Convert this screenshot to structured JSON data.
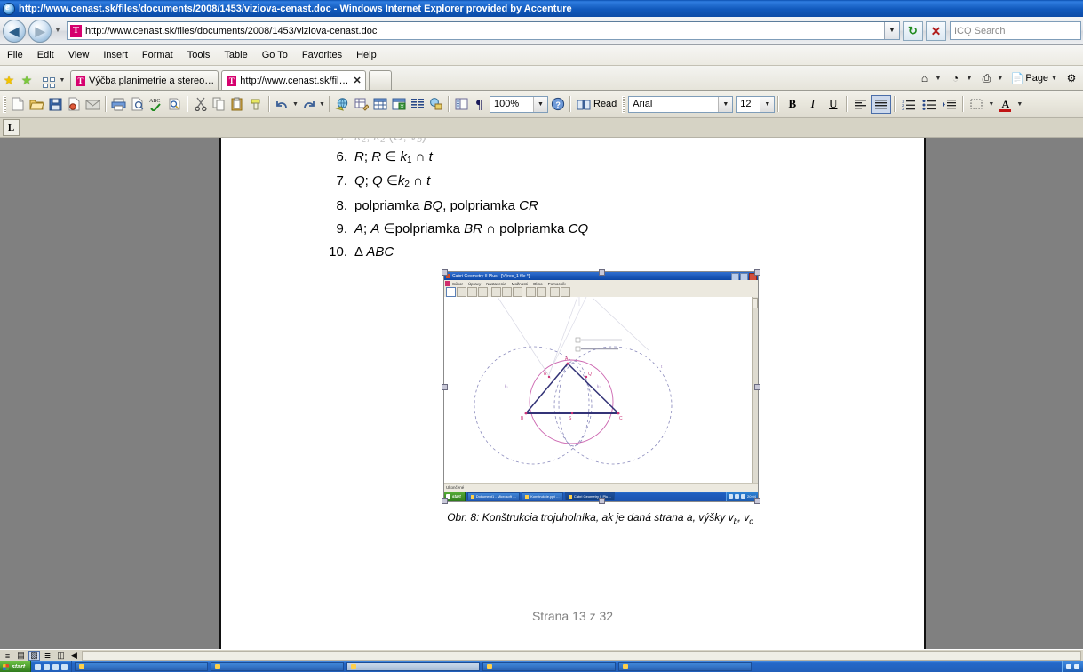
{
  "window": {
    "title": "http://www.cenast.sk/files/documents/2008/1453/viziova-cenast.doc - Windows Internet Explorer provided by Accenture",
    "logo_icon": "ie-logo-icon"
  },
  "address_bar": {
    "back_label": "◀",
    "forward_label": "▶",
    "history_caret": "▼",
    "url": "http://www.cenast.sk/files/documents/2008/1453/viziova-cenast.doc",
    "doc_icon_letter": "T",
    "dropdown_caret": "▼",
    "refresh_icon": "↻",
    "stop_icon": "✕",
    "search_placeholder": "ICQ Search"
  },
  "menu": {
    "items": [
      {
        "label": "File"
      },
      {
        "label": "Edit"
      },
      {
        "label": "View"
      },
      {
        "label": "Insert"
      },
      {
        "label": "Format"
      },
      {
        "label": "Tools"
      },
      {
        "label": "Table"
      },
      {
        "label": "Go To"
      },
      {
        "label": "Favorites"
      },
      {
        "label": "Help"
      }
    ]
  },
  "tabbar": {
    "favorites_icon": "★",
    "add_favorite_icon": "★",
    "quick_tabs_icon": "quick-tabs-icon",
    "tab_list_caret": "▼",
    "tabs": [
      {
        "label": "Výčba planimetrie a stereo…",
        "icon_letter": "T",
        "active": false,
        "close": ""
      },
      {
        "label": "http://www.cenast.sk/fil…",
        "icon_letter": "T",
        "active": true,
        "close": "✕"
      }
    ],
    "new_tab_label": "",
    "commands": {
      "home_icon": "⌂",
      "feeds_icon": "◔",
      "print_icon": "⎙",
      "page_label": "Page",
      "tools_icon": "⚙",
      "caret": "▼"
    }
  },
  "word_toolbar": {
    "buttons": [
      {
        "name": "new-document",
        "icon": "new"
      },
      {
        "name": "open",
        "icon": "open"
      },
      {
        "name": "save",
        "icon": "save"
      },
      {
        "name": "permission",
        "icon": "permission"
      },
      {
        "name": "email",
        "icon": "email"
      },
      {
        "name": "print",
        "icon": "print"
      },
      {
        "name": "print-preview",
        "icon": "preview"
      },
      {
        "name": "spelling-grammar",
        "icon": "spell"
      },
      {
        "name": "research",
        "icon": "research"
      },
      {
        "name": "cut",
        "icon": "cut"
      },
      {
        "name": "copy",
        "icon": "copy"
      },
      {
        "name": "paste",
        "icon": "paste"
      },
      {
        "name": "format-painter",
        "icon": "painter"
      },
      {
        "name": "undo",
        "icon": "undo"
      },
      {
        "name": "redo",
        "icon": "redo"
      },
      {
        "name": "insert-hyperlink",
        "icon": "hyperlink"
      },
      {
        "name": "tables-and-borders",
        "icon": "tables-borders"
      },
      {
        "name": "insert-table",
        "icon": "table"
      },
      {
        "name": "insert-excel-worksheet",
        "icon": "excel"
      },
      {
        "name": "columns",
        "icon": "columns"
      },
      {
        "name": "drawing",
        "icon": "drawing"
      },
      {
        "name": "document-map",
        "icon": "docmap"
      },
      {
        "name": "show-formatting-marks",
        "icon": "pilcrow"
      }
    ],
    "zoom_value": "100%",
    "help_icon": "?",
    "read_label": "Read",
    "font_value": "Arial",
    "size_value": "12",
    "bold_label": "B",
    "italic_label": "I",
    "underline_label": "U",
    "align_left_icon": "align-left",
    "align_center_icon": "align-center",
    "numbering_icon": "numbering",
    "bullets_icon": "bullets",
    "increase_indent_icon": "increase-indent",
    "borders_icon": "borders",
    "font_color_label": "A",
    "caret": "▼"
  },
  "ruler": {
    "tab_selector_label": "L"
  },
  "document": {
    "list_items": [
      {
        "num": "6.",
        "parts": [
          {
            "t": "R",
            "i": true
          },
          {
            "t": "; ",
            "i": false
          },
          {
            "t": "R",
            "i": true
          },
          {
            "t": " ∈ ",
            "i": false
          },
          {
            "t": "k",
            "i": true
          },
          {
            "t": "1",
            "sub": true
          },
          {
            "t": " ∩ ",
            "i": false
          },
          {
            "t": "t",
            "i": true
          }
        ]
      },
      {
        "num": "7.",
        "parts": [
          {
            "t": "Q",
            "i": true
          },
          {
            "t": "; ",
            "i": false
          },
          {
            "t": "Q",
            "i": true
          },
          {
            "t": " ∈",
            "i": false
          },
          {
            "t": "k",
            "i": true
          },
          {
            "t": "2",
            "sub": true
          },
          {
            "t": " ∩ ",
            "i": false
          },
          {
            "t": "t",
            "i": true
          }
        ]
      },
      {
        "num": "8.",
        "parts": [
          {
            "t": "polpriamka ",
            "i": false
          },
          {
            "t": "BQ",
            "i": true
          },
          {
            "t": ", polpriamka ",
            "i": false
          },
          {
            "t": "CR",
            "i": true
          }
        ]
      },
      {
        "num": "9.",
        "parts": [
          {
            "t": "A",
            "i": true
          },
          {
            "t": "; ",
            "i": false
          },
          {
            "t": "A",
            "i": true
          },
          {
            "t": " ∈",
            "i": false
          },
          {
            "t": "polpriamka ",
            "i": false
          },
          {
            "t": "BR",
            "i": true
          },
          {
            "t": " ∩ ",
            "i": false
          },
          {
            "t": "polpriamka ",
            "i": false
          },
          {
            "t": "CQ",
            "i": true
          }
        ]
      },
      {
        "num": "10.",
        "parts": [
          {
            "t": "Δ ",
            "i": false
          },
          {
            "t": "ABC",
            "i": true
          }
        ]
      }
    ],
    "figure": {
      "caption_prefix": "Obr. 8: Konštrukcia trojuholníka, ak je daná strana ",
      "caption_a": "a",
      "caption_mid": ", výšky ",
      "caption_vb": "v",
      "caption_vb_sub": "b",
      "caption_sep": ", ",
      "caption_vc": "v",
      "caption_vc_sub": "c",
      "embedded_window": {
        "title": "Cabri Geometry II Plus - [Výres_1 file *]",
        "menus": [
          "Súbor",
          "Úpravy",
          "Nastavenia",
          "Možnosti",
          "Okno",
          "Pomocník"
        ],
        "status": "Ukončené",
        "taskbar": {
          "start_label": "start",
          "tasks": [
            {
              "label": "Dokument1 - Microsoft …",
              "active": false
            },
            {
              "label": "Konstrukcie.ppt …",
              "active": false
            },
            {
              "label": "Cabri Geometry II Plu…",
              "active": true
            }
          ],
          "clock": "20:04"
        },
        "figure_labels": {
          "A": "A",
          "B": "B",
          "C": "C",
          "k1": "k₁",
          "k2": "k₂",
          "t": "t",
          "Q": "Q",
          "R": "R",
          "S": "S"
        }
      }
    },
    "page_footer": "Strana 13 z 32"
  },
  "word_status": {
    "view_buttons": [
      {
        "name": "normal-view",
        "icon": "≡",
        "active": false
      },
      {
        "name": "web-layout-view",
        "icon": "▤",
        "active": false
      },
      {
        "name": "print-layout-view",
        "icon": "▧",
        "active": true
      },
      {
        "name": "outline-view",
        "icon": "≣",
        "active": false
      },
      {
        "name": "reading-layout-view",
        "icon": "◫",
        "active": false
      }
    ],
    "scroll_left_icon": "◀"
  },
  "taskbar": {
    "start_label": "start",
    "items": [
      {
        "label": "",
        "active": false
      },
      {
        "label": "",
        "active": false
      },
      {
        "label": "",
        "active": true
      },
      {
        "label": "",
        "active": false
      },
      {
        "label": "",
        "active": false
      }
    ]
  },
  "colors": {
    "titlebar_blue": "#1159bc",
    "accent_magenta": "#d6006e",
    "desktop_gray": "#808080",
    "toolbar_beige": "#e8e6dc",
    "figure_pink": "#cc66b0",
    "figure_navy": "#333377"
  }
}
